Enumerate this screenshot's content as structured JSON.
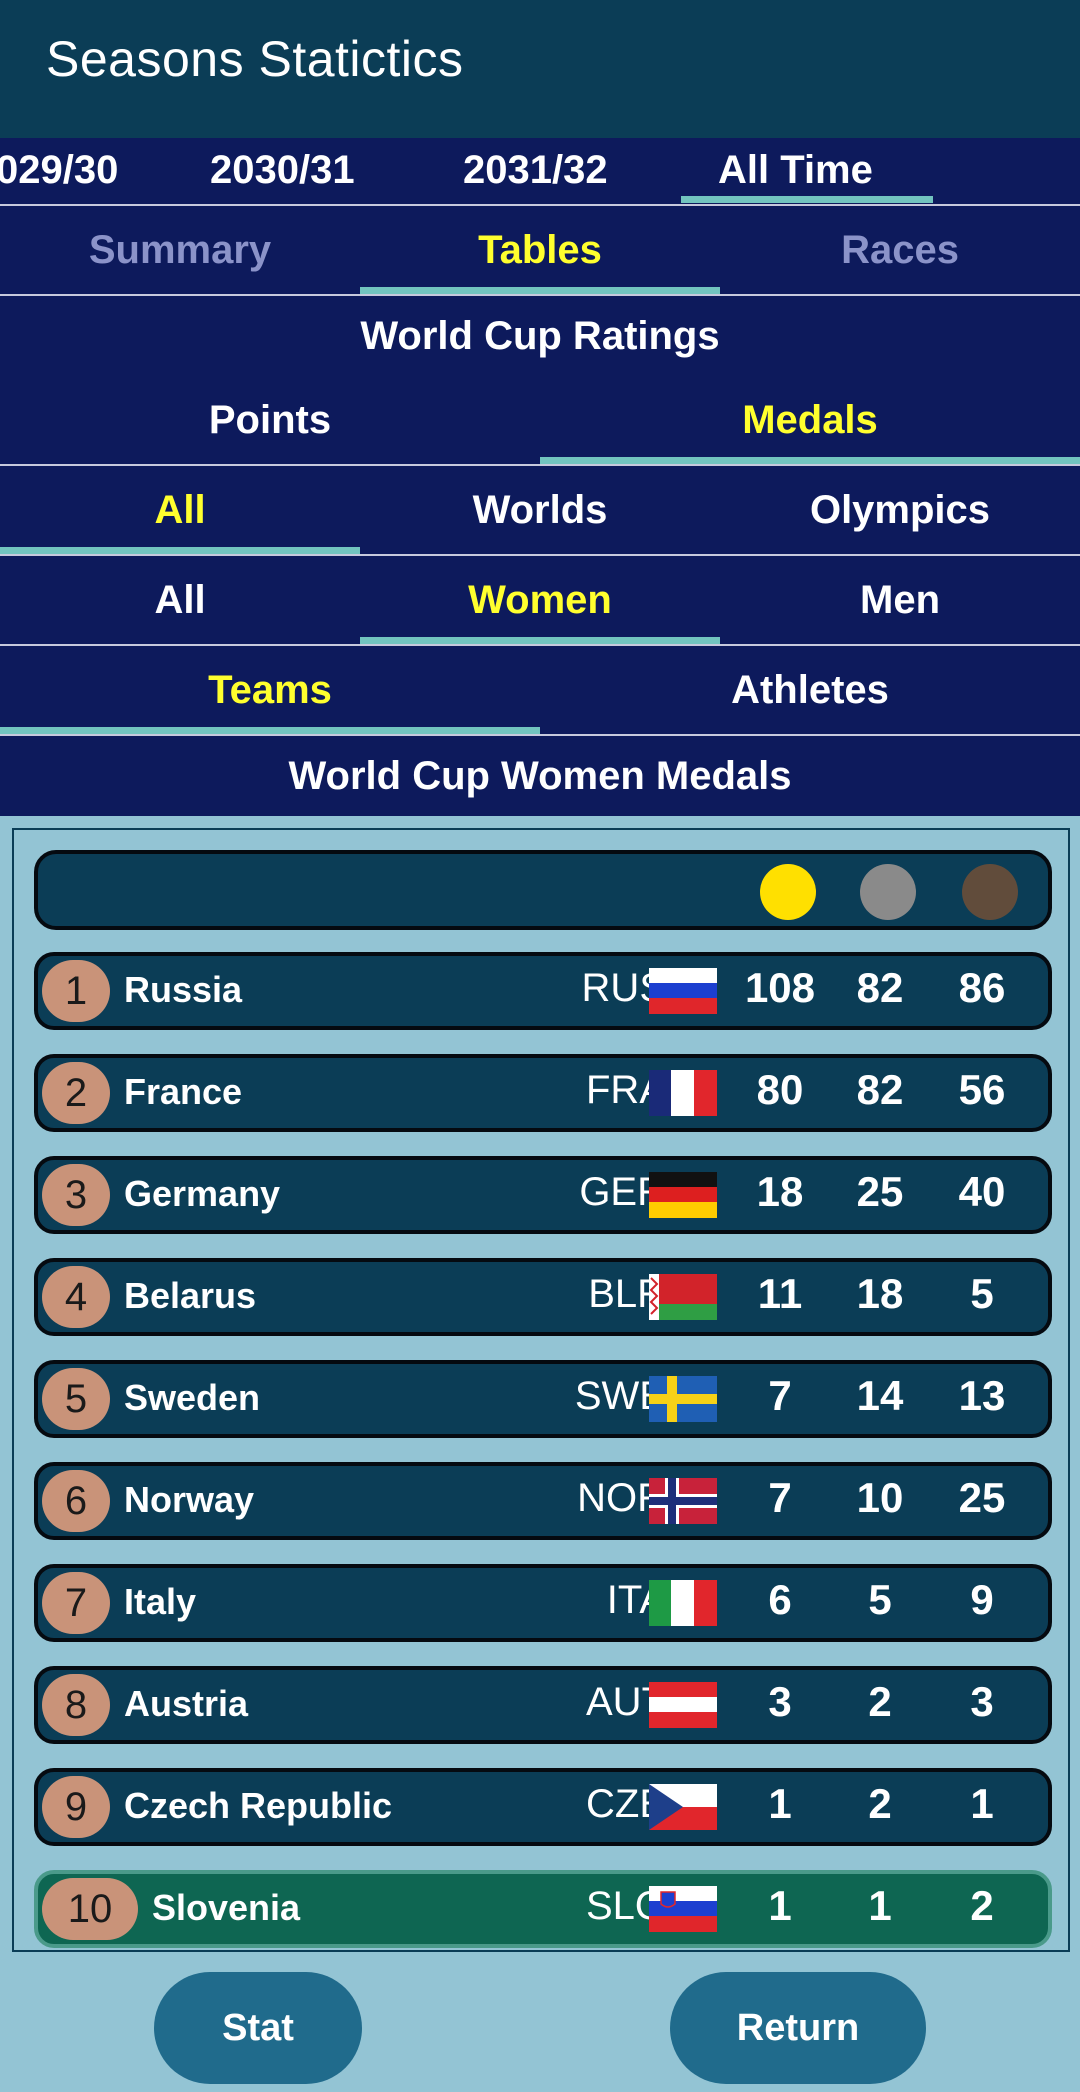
{
  "app": {
    "title": "Seasons Statictics"
  },
  "seasons": [
    "029/30",
    "2030/31",
    "2031/32",
    "All Time"
  ],
  "view_tabs": [
    "Summary",
    "Tables",
    "Races"
  ],
  "ratings_title": "World Cup Ratings",
  "rating_tabs": [
    "Points",
    "Medals"
  ],
  "competition_tabs": [
    "All",
    "Worlds",
    "Olympics"
  ],
  "gender_tabs": [
    "All",
    "Women",
    "Men"
  ],
  "entity_tabs": [
    "Teams",
    "Athletes"
  ],
  "table_title": "World Cup Women Medals",
  "medal_colors": {
    "gold": "#ffe000",
    "silver": "#8a8a8a",
    "bronze": "#614c3b"
  },
  "rows": [
    {
      "rank": "1",
      "country": "Russia",
      "code": "RUS",
      "flag": "russia-flag-icon",
      "gold": "108",
      "silver": "82",
      "bronze": "86"
    },
    {
      "rank": "2",
      "country": "France",
      "code": "FRA",
      "flag": "france-flag-icon",
      "gold": "80",
      "silver": "82",
      "bronze": "56"
    },
    {
      "rank": "3",
      "country": "Germany",
      "code": "GER",
      "flag": "germany-flag-icon",
      "gold": "18",
      "silver": "25",
      "bronze": "40"
    },
    {
      "rank": "4",
      "country": "Belarus",
      "code": "BLR",
      "flag": "belarus-flag-icon",
      "gold": "11",
      "silver": "18",
      "bronze": "5"
    },
    {
      "rank": "5",
      "country": "Sweden",
      "code": "SWE",
      "flag": "sweden-flag-icon",
      "gold": "7",
      "silver": "14",
      "bronze": "13"
    },
    {
      "rank": "6",
      "country": "Norway",
      "code": "NOR",
      "flag": "norway-flag-icon",
      "gold": "7",
      "silver": "10",
      "bronze": "25"
    },
    {
      "rank": "7",
      "country": "Italy",
      "code": "ITA",
      "flag": "italy-flag-icon",
      "gold": "6",
      "silver": "5",
      "bronze": "9"
    },
    {
      "rank": "8",
      "country": "Austria",
      "code": "AUT",
      "flag": "austria-flag-icon",
      "gold": "3",
      "silver": "2",
      "bronze": "3"
    },
    {
      "rank": "9",
      "country": "Czech Republic",
      "code": "CZE",
      "flag": "czech-flag-icon",
      "gold": "1",
      "silver": "2",
      "bronze": "1"
    },
    {
      "rank": "10",
      "country": "Slovenia",
      "code": "SLO",
      "flag": "slovenia-flag-icon",
      "gold": "1",
      "silver": "1",
      "bronze": "2"
    }
  ],
  "buttons": {
    "stat": "Stat",
    "return": "Return"
  }
}
